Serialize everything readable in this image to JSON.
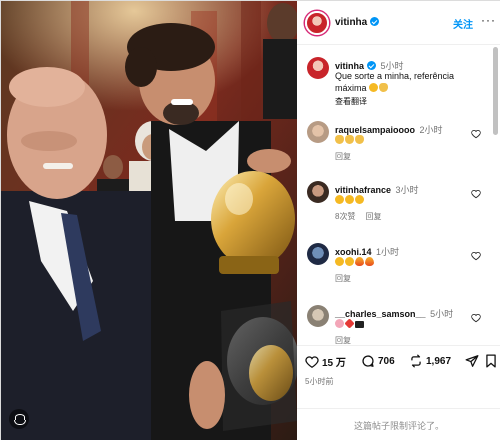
{
  "post": {
    "author": "vitinha",
    "follow_label": "关注",
    "more_label": "···",
    "caption_line1": "Que sorte a minha, referência",
    "caption_line2": "máxima",
    "caption_time": "5小时",
    "see_translation": "查看翻译",
    "caption_emojis": [
      "smiling-heart-eyes",
      "heart-hands"
    ]
  },
  "comments": [
    {
      "username": "raquelsampaioooo",
      "time": "2小时",
      "emojis": [
        "clap",
        "clap",
        "clap"
      ],
      "reply_label": "回复",
      "likes_label": ""
    },
    {
      "username": "vitinhafrance",
      "time": "3小时",
      "emojis": [
        "heart-eyes",
        "heart-eyes",
        "heart-eyes"
      ],
      "likes_label": "8次赞",
      "reply_label": "回复"
    },
    {
      "username": "xoohi.14",
      "time": "1小时",
      "emojis": [
        "heart-eyes",
        "heart-eyes",
        "fire",
        "fire"
      ],
      "reply_label": "回复",
      "likes_label": ""
    },
    {
      "username": "__charles_samson__",
      "time": "5小时",
      "emojis": [
        "brain",
        "heart",
        "top-hat"
      ],
      "reply_label": "回复",
      "likes_label": ""
    }
  ],
  "actions": {
    "likes": "15 万",
    "comments": "706",
    "reposts": "1,967"
  },
  "posted_ago": "5小时前",
  "comments_limited": "这篇帖子限制评论了。",
  "colors": {
    "accent": "#0095f6",
    "muted": "#737373",
    "verified": "#0095f6"
  }
}
